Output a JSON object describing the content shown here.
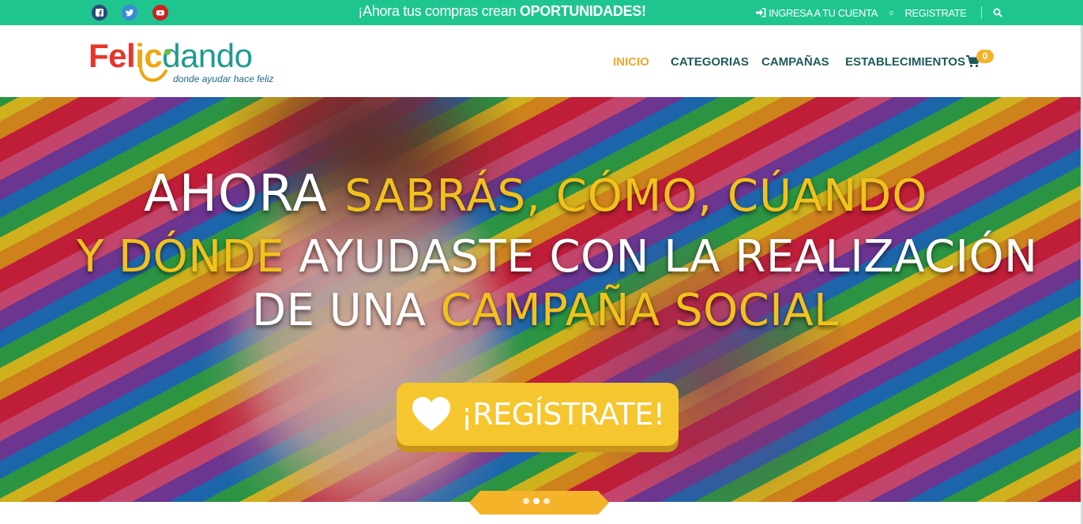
{
  "topbar": {
    "social": [
      "facebook-icon",
      "twitter-icon",
      "youtube-icon"
    ],
    "promo_text": "¡Ahora tus compras crean ",
    "promo_bold": "OPORTUNIDADES!",
    "login_label": "INGRESA A TU CUENTA",
    "or_label": "o",
    "register_label": "REGISTRATE",
    "background": "#1fc58f"
  },
  "logo": {
    "fel": "Fel",
    "ci": "ic",
    "dando": "dando",
    "tagline": "donde ayudar hace feliz"
  },
  "nav": {
    "items": [
      {
        "label": "INICIO",
        "active": true
      },
      {
        "label": "CATEGORIAS",
        "active": false
      },
      {
        "label": "CAMPAÑAS",
        "active": false
      },
      {
        "label": "ESTABLECIMIENTOS",
        "active": false
      }
    ],
    "cart_count": "0",
    "active_color": "#f2a82c",
    "link_color": "#1e5a5a"
  },
  "hero": {
    "line1_white": "AHORA ",
    "line1_yellow": "SABRÁS, CÓMO, CÚANDO",
    "line2_yellow": "Y DÓNDE ",
    "line2_white": "AYUDASTE CON LA REALIZACIÓN",
    "line3_white": "DE UNA ",
    "line3_yellow": "CAMPAÑA SOCIAL",
    "cta_label": "¡REGÍSTRATE!",
    "accent": "#f2c21b",
    "slides": 3,
    "active_slide": 2
  }
}
